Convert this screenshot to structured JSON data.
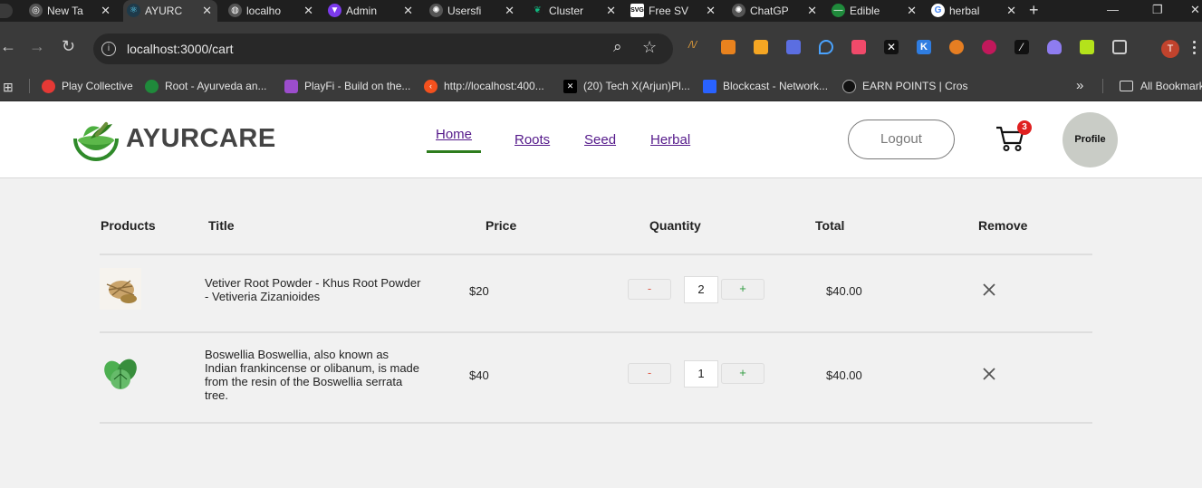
{
  "browser": {
    "tabs": [
      {
        "title": "New Ta"
      },
      {
        "title": "AYURC"
      },
      {
        "title": "localho"
      },
      {
        "title": "Admin"
      },
      {
        "title": "Usersfi"
      },
      {
        "title": "Cluster"
      },
      {
        "title": "Free SV"
      },
      {
        "title": "ChatGP"
      },
      {
        "title": "Edible"
      },
      {
        "title": "herbal"
      }
    ],
    "add_tab": "+",
    "url": "localhost:3000/cart",
    "profile_initial": "T",
    "bookmarks": [
      {
        "label": "Play Collective"
      },
      {
        "label": "Root - Ayurveda an..."
      },
      {
        "label": "PlayFi - Build on the..."
      },
      {
        "label": "http://localhost:400..."
      },
      {
        "label": "(20) Tech X(Arjun)Pl..."
      },
      {
        "label": "Blockcast - Network..."
      },
      {
        "label": "EARN POINTS | Cros"
      }
    ],
    "bookmarks_more": "»",
    "all_bookmarks": "All Bookmarks"
  },
  "site": {
    "brand": "AYURCARE",
    "nav": {
      "home": "Home",
      "roots": "Roots",
      "seed": "Seed",
      "herbal": "Herbal"
    },
    "logout": "Logout",
    "cart_count": "3",
    "profile": "Profile",
    "accent": "#2e7d1e"
  },
  "cart": {
    "headers": {
      "products": "Products",
      "title": "Title",
      "price": "Price",
      "quantity": "Quantity",
      "total": "Total",
      "remove": "Remove"
    },
    "items": [
      {
        "title": "Vetiver Root Powder - Khus Root Powder - Vetiveria Zizanioides",
        "price": "$20",
        "minus": "-",
        "quantity": "2",
        "plus": "+",
        "total": "$40.00"
      },
      {
        "title": "Boswellia Boswellia, also known as Indian frankincense or olibanum, is made from the resin of the Boswellia serrata tree.",
        "price": "$40",
        "minus": "-",
        "quantity": "1",
        "plus": "+",
        "total": "$40.00"
      }
    ]
  }
}
